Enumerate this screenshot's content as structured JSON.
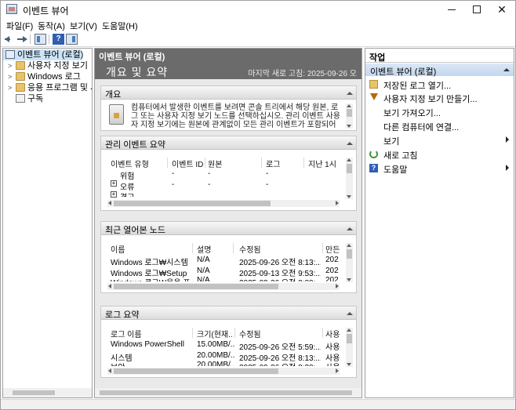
{
  "window": {
    "title": "이벤트 뷰어",
    "minimize_icon": "minimize-icon",
    "maximize_icon": "maximize-icon",
    "close_glyph": "✕"
  },
  "menu": [
    "파일(F)",
    "동작(A)",
    "보기(V)",
    "도움말(H)"
  ],
  "toolbar": {
    "icons": [
      "back-arrow-icon",
      "forward-arrow-icon",
      "show-hide-console-tree-icon",
      "help-icon",
      "show-hide-action-pane-icon"
    ],
    "help_glyph": "?"
  },
  "tree": {
    "root": "이벤트 뷰어 (로컬)",
    "items": [
      "사용자 지정 보기",
      "Windows 로그",
      "응용 프로그램 및 서비스 로그",
      "구독"
    ]
  },
  "center": {
    "header": "이벤트 뷰어 (로컬)",
    "summary_title": "개요 및 요약",
    "last_refresh": "마지막 새로 고침: 2025-09-26 오",
    "sections": {
      "overview": {
        "title": "개요",
        "text_line1": "컴퓨터에서 발생한 이벤트를 보려면 콘솔 트리에서 해당 원본, 로",
        "text_line2": "그 또는 사용자 지정 보기 노드를 선택하십시오. 관리 이벤트 사용",
        "text_line3": "자 지정 보기에는 원본에 관계없이 모든 관리 이벤트가 포함되어"
      },
      "admin_events": {
        "title": "관리 이벤트 요약",
        "columns": [
          "이벤트 유형",
          "이벤트 ID",
          "원본",
          "로그",
          "지난 1시"
        ],
        "rows": [
          [
            "위험",
            "-",
            "-",
            "-"
          ],
          [
            "오류",
            "-",
            "-",
            "-"
          ],
          [
            "경고",
            "",
            "",
            ""
          ]
        ]
      },
      "recent_nodes": {
        "title": "최근 열어본 노드",
        "columns": [
          "이름",
          "설명",
          "수정됨",
          "만든"
        ],
        "rows": [
          [
            "Windows 로그₩시스템",
            "N/A",
            "2025-09-26 오전 8:13:...",
            "202"
          ],
          [
            "Windows 로그₩Setup",
            "N/A",
            "2025-09-13 오전 9:53:...",
            "202"
          ],
          [
            "Windows 로그₩응용 프",
            "N/A",
            "2025-09-26 오전 8:00:...",
            "202"
          ]
        ]
      },
      "log_summary": {
        "title": "로그 요약",
        "columns": [
          "로그 이름",
          "크기(현재...",
          "수정됨",
          "사용"
        ],
        "rows": [
          [
            "Windows PowerShell",
            "15.00MB/...",
            "2025-09-26 오전 5:59:...",
            "사용"
          ],
          [
            "시스템",
            "20.00MB/...",
            "2025-09-26 오전 8:13:...",
            "사용"
          ],
          [
            "보안",
            "20.00MB/...",
            "2025-09-26 오전 8:20:...",
            "사용"
          ]
        ]
      }
    }
  },
  "actions": {
    "header": "작업",
    "group": "이벤트 뷰어 (로컬)",
    "items": [
      {
        "label": "저장된 로그 열기...",
        "icon": "open-saved-log-icon"
      },
      {
        "label": "사용자 지정 보기 만들기...",
        "icon": "filter-icon"
      },
      {
        "label": "보기 가져오기...",
        "icon": ""
      },
      {
        "label": "다른 컴퓨터에 연결...",
        "icon": ""
      },
      {
        "label": "보기",
        "icon": "",
        "submenu": true
      },
      {
        "label": "새로 고침",
        "icon": "refresh-icon"
      },
      {
        "label": "도움말",
        "icon": "help-icon",
        "submenu": true
      }
    ]
  }
}
